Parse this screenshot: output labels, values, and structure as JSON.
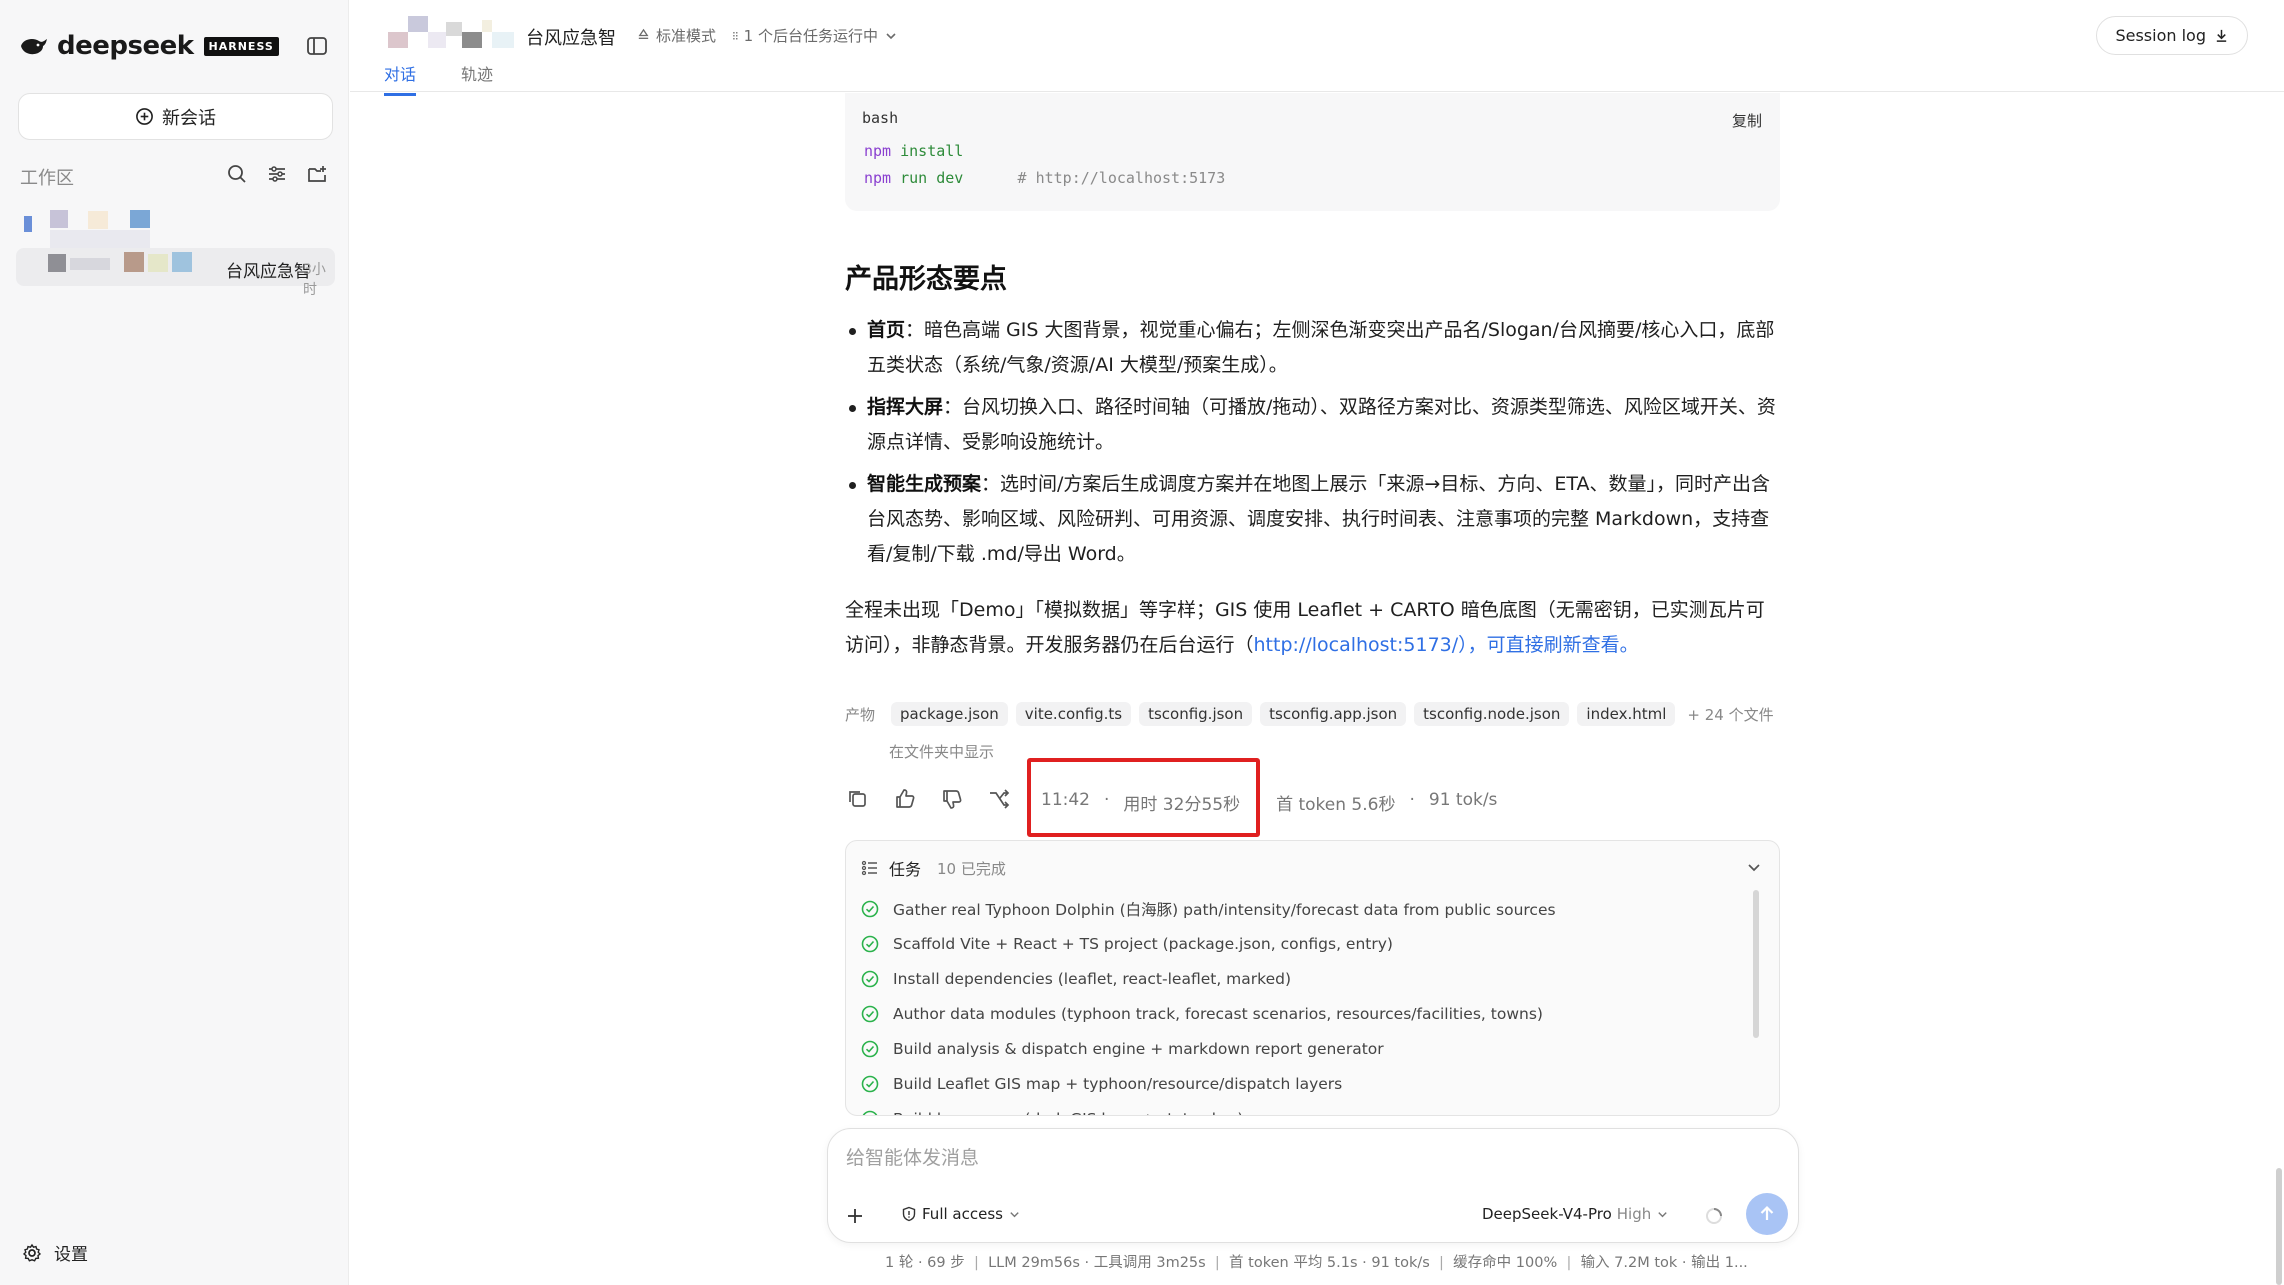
{
  "sidebar": {
    "logo_text": "deepseek",
    "logo_badge": "HARNESS",
    "new_chat": "新会话",
    "workspace_label": "工作区",
    "item": {
      "title": "台风应急智",
      "time": "3小时"
    },
    "settings": "设置"
  },
  "header": {
    "title": "台风应急智",
    "mode": "标准模式",
    "bg_tasks": "1 个后台任务运行中",
    "tabs": [
      "对话",
      "轨迹"
    ],
    "session_log": "Session log"
  },
  "code": {
    "lang": "bash",
    "copy": "复制",
    "lines": [
      {
        "cmd": "npm",
        "arg": "install",
        "comment": ""
      },
      {
        "cmd": "npm",
        "arg": "run dev",
        "comment": "# http://localhost:5173"
      }
    ]
  },
  "content": {
    "heading": "产品形态要点",
    "bullets": [
      {
        "bold": "首页",
        "text": "：暗色高端 GIS 大图背景，视觉重心偏右；左侧深色渐变突出产品名/Slogan/台风摘要/核心入口，底部五类状态（系统/气象/资源/AI 大模型/预案生成）。"
      },
      {
        "bold": "指挥大屏",
        "text": "：台风切换入口、路径时间轴（可播放/拖动）、双路径方案对比、资源类型筛选、风险区域开关、资源点详情、受影响设施统计。"
      },
      {
        "bold": "智能生成预案",
        "text": "：选时间/方案后生成调度方案并在地图上展示「来源→目标、方向、ETA、数量」，同时产出含台风态势、影响区域、风险研判、可用资源、调度安排、执行时间表、注意事项的完整 Markdown，支持查看/复制/下载 .md/导出 Word。"
      }
    ],
    "para_text": "全程未出现「Demo」「模拟数据」等字样；GIS 使用 Leaflet + CARTO 暗色底图（无需密钥，已实测瓦片可访问），非静态背景。开发服务器仍在后台运行（",
    "para_link": "http://localhost:5173/",
    "para_tail": "），可直接刷新查看。"
  },
  "artifacts": {
    "label": "产物",
    "files": [
      "package.json",
      "vite.config.ts",
      "tsconfig.json",
      "tsconfig.app.json",
      "tsconfig.node.json",
      "index.html"
    ],
    "more": "+ 24 个文件",
    "show_in_folder": "在文件夹中显示"
  },
  "meta": {
    "time": "11:42",
    "sep1": "·",
    "duration": "用时 32分55秒",
    "first_token": "首 token 5.6秒",
    "sep2": "·",
    "speed": "91 tok/s"
  },
  "tasks": {
    "title": "任务",
    "count": "10 已完成",
    "items": [
      "Gather real Typhoon Dolphin (白海豚) path/intensity/forecast data from public sources",
      "Scaffold Vite + React + TS project (package.json, configs, entry)",
      "Install dependencies (leaflet, react-leaflet, marked)",
      "Author data modules (typhoon track, forecast scenarios, resources/facilities, towns)",
      "Build analysis & dispatch engine + markdown report generator",
      "Build Leaflet GIS map + typhoon/resource/dispatch layers",
      "Build homepage (dark GIS hero + status bar)"
    ]
  },
  "composer": {
    "placeholder": "给智能体发消息",
    "access": "Full access",
    "model": "DeepSeek-V4-Pro",
    "level": "High"
  },
  "status_bar": [
    "1 轮 · 69 步",
    "LLM 29m56s · 工具调用 3m25s",
    "首 token 平均 5.1s · 91 tok/s",
    "缓存命中 100%",
    "输入 7.2M tok · 输出 1..."
  ],
  "colors": {
    "accent": "#2f6fe4",
    "success": "#2bb24c",
    "highlight": "#e02020"
  }
}
